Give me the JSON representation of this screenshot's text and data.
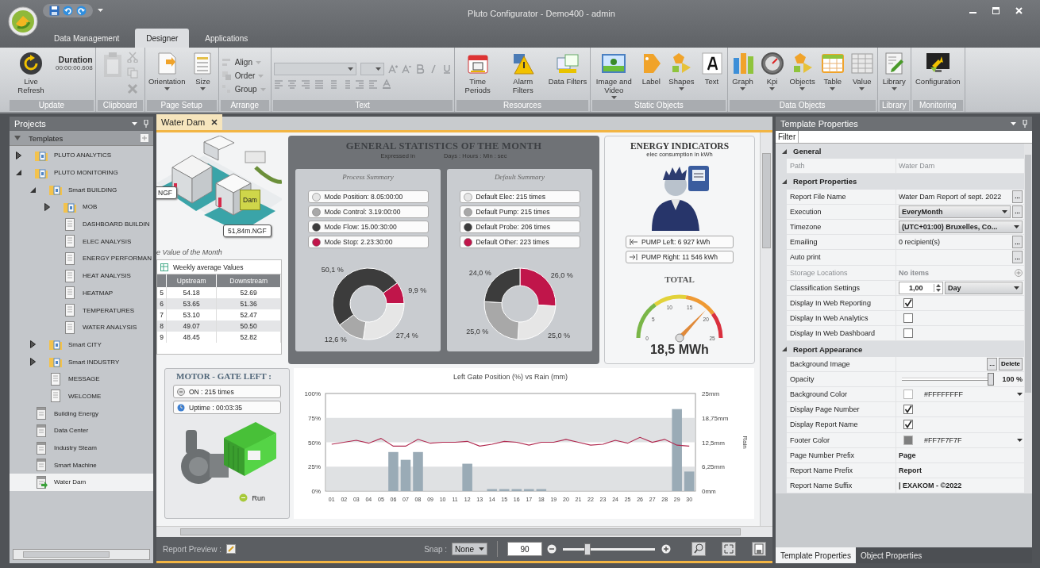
{
  "window": {
    "title": "Pluto Configurator - Demo400 - admin"
  },
  "ribbon_tabs": [
    {
      "label": "Data Management",
      "selected": false
    },
    {
      "label": "Designer",
      "selected": true
    },
    {
      "label": "Applications",
      "selected": false
    }
  ],
  "ribbon_groups": [
    {
      "label": "Update",
      "kind": "buttons",
      "items": [
        {
          "kind": "large",
          "label": "Live Refresh",
          "dropdown": false,
          "disabled": false
        },
        {
          "kind": "info",
          "title": "Duration",
          "value": "00:00:00.608"
        }
      ]
    },
    {
      "label": "Clipboard",
      "kind": "clipboard",
      "disabled": true
    },
    {
      "label": "Page Setup",
      "kind": "buttons",
      "items": [
        {
          "kind": "large",
          "label": "Orientation",
          "dropdown": true,
          "disabled": false
        },
        {
          "kind": "large",
          "label": "Size",
          "dropdown": true,
          "disabled": false
        }
      ]
    },
    {
      "label": "Arrange",
      "kind": "buttons",
      "items": [
        {
          "kind": "small",
          "label": "Align",
          "dropdown": true,
          "disabled": true
        },
        {
          "kind": "small",
          "label": "Order",
          "dropdown": true,
          "disabled": true
        },
        {
          "kind": "small",
          "label": "Group",
          "dropdown": true,
          "disabled": true
        }
      ]
    },
    {
      "label": "Text",
      "kind": "text-format",
      "disabled": true
    },
    {
      "label": "Resources",
      "kind": "buttons",
      "items": [
        {
          "kind": "large",
          "label": "Time Periods",
          "dropdown": false,
          "disabled": false
        },
        {
          "kind": "large",
          "label": "Alarm Filters",
          "dropdown": false,
          "disabled": false
        },
        {
          "kind": "large",
          "label": "Data Filters",
          "dropdown": false,
          "disabled": false
        }
      ]
    },
    {
      "label": "Static Objects",
      "kind": "buttons",
      "items": [
        {
          "kind": "large",
          "label": "Image and Video",
          "dropdown": true,
          "disabled": false
        },
        {
          "kind": "large",
          "label": "Label",
          "dropdown": false,
          "disabled": false
        },
        {
          "kind": "large",
          "label": "Shapes",
          "dropdown": true,
          "disabled": false
        },
        {
          "kind": "large",
          "label": "Text",
          "dropdown": false,
          "disabled": false
        }
      ]
    },
    {
      "label": "Data Objects",
      "kind": "buttons",
      "items": [
        {
          "kind": "large",
          "label": "Graph",
          "dropdown": true,
          "disabled": false
        },
        {
          "kind": "large",
          "label": "Kpi",
          "dropdown": true,
          "disabled": false
        },
        {
          "kind": "large",
          "label": "Objects",
          "dropdown": true,
          "disabled": false
        },
        {
          "kind": "large",
          "label": "Table",
          "dropdown": true,
          "disabled": false
        },
        {
          "kind": "large",
          "label": "Value",
          "dropdown": true,
          "disabled": false
        }
      ]
    },
    {
      "label": "Library",
      "kind": "buttons",
      "items": [
        {
          "kind": "large",
          "label": "Library",
          "dropdown": true,
          "disabled": false
        }
      ]
    },
    {
      "label": "Monitoring",
      "kind": "buttons",
      "items": [
        {
          "kind": "large",
          "label": "Configuration",
          "dropdown": false,
          "disabled": false
        }
      ]
    }
  ],
  "projects": {
    "title": "Projects",
    "root": {
      "label": "Templates",
      "expanded": true
    },
    "tree": [
      {
        "label": "PLUTO ANALYTICS",
        "kind": "folder",
        "expanded": false,
        "selected": false
      },
      {
        "label": "PLUTO MONITORING",
        "kind": "folder",
        "expanded": true,
        "selected": false,
        "children": [
          {
            "label": "Smart BUILDING",
            "kind": "folder",
            "expanded": true,
            "selected": false,
            "children": [
              {
                "label": "MOB",
                "kind": "folder",
                "expanded": false,
                "selected": false
              },
              {
                "label": "DASHBOARD BUILDIN",
                "kind": "page",
                "selected": false
              },
              {
                "label": "ELEC ANALYSIS",
                "kind": "page",
                "selected": false
              },
              {
                "label": "ENERGY PERFORMAN",
                "kind": "page",
                "selected": false
              },
              {
                "label": "HEAT ANALYSIS",
                "kind": "page",
                "selected": false
              },
              {
                "label": "HEATMAP",
                "kind": "page",
                "selected": false
              },
              {
                "label": "TEMPERATURES",
                "kind": "page",
                "selected": false
              },
              {
                "label": "WATER ANALYSIS",
                "kind": "page",
                "selected": false
              }
            ]
          },
          {
            "label": "Smart CITY",
            "kind": "folder",
            "expanded": false,
            "selected": false
          },
          {
            "label": "Smart INDUSTRY",
            "kind": "folder",
            "expanded": false,
            "selected": false
          },
          {
            "label": "MESSAGE",
            "kind": "page",
            "selected": false
          },
          {
            "label": "WELCOME",
            "kind": "page",
            "selected": false
          }
        ]
      },
      {
        "label": "Building Energy",
        "kind": "template",
        "selected": false
      },
      {
        "label": "Data Center",
        "kind": "template",
        "selected": false
      },
      {
        "label": "Industry Steam",
        "kind": "template",
        "selected": false
      },
      {
        "label": "Smart Machine",
        "kind": "template",
        "selected": false
      },
      {
        "label": "Water Dam",
        "kind": "template",
        "selected": true
      }
    ]
  },
  "document_tab": {
    "label": "Water Dam"
  },
  "dam": {
    "level_label": "NGF",
    "callout": "Dam",
    "elevation": "51,84m.NGF",
    "caption": "e Value of the Month",
    "table": {
      "title": "Weekly average Values",
      "columns": [
        "",
        "Upstream",
        "Downstream"
      ],
      "rows": [
        [
          "5",
          "54.18",
          "52.69"
        ],
        [
          "6",
          "53.65",
          "51.36"
        ],
        [
          "7",
          "53.10",
          "52.47"
        ],
        [
          "8",
          "49.07",
          "50.50"
        ],
        [
          "9",
          "48.45",
          "52.82"
        ]
      ]
    }
  },
  "statistics": {
    "title": "GENERAL STATISTICS OF THE MONTH",
    "subtitle_left": "Expressed in",
    "subtitle_right": "Days : Hours : Min : sec",
    "summaries": [
      {
        "title": "Process Summary",
        "items": [
          {
            "label": "Mode Position: 8.05:00:00",
            "color": "#e6e6e6"
          },
          {
            "label": "Mode Control: 3.19:00:00",
            "color": "#a8a8a8"
          },
          {
            "label": "Mode Flow: 15.00:30:00",
            "color": "#3c3c3c"
          },
          {
            "label": "Mode Stop: 2.23:30:00",
            "color": "#c0154a"
          }
        ],
        "chart_data": {
          "type": "donut",
          "values": [
            27.4,
            12.6,
            50.1,
            9.9
          ],
          "value_labels": [
            "27,4 %",
            "12,6 %",
            "50,1 %",
            "9,9 %"
          ]
        }
      },
      {
        "title": "Default Summary",
        "items": [
          {
            "label": "Default Elec: 215 times",
            "color": "#e6e6e6"
          },
          {
            "label": "Default Pump: 215 times",
            "color": "#a8a8a8"
          },
          {
            "label": "Default Probe: 206 times",
            "color": "#3c3c3c"
          },
          {
            "label": "Default Other: 223 times",
            "color": "#c0154a"
          }
        ],
        "chart_data": {
          "type": "donut",
          "values": [
            25.0,
            25.0,
            24.0,
            26.0
          ],
          "value_labels": [
            "25,0 %",
            "25,0 %",
            "24,0 %",
            "26,0 %"
          ]
        }
      }
    ]
  },
  "energy": {
    "title": "ENERGY INDICATORS",
    "subtitle": "elec consumption in kWh",
    "pumps": [
      "PUMP Left: 6 927 kWh",
      "PUMP Right: 11 546 kWh"
    ],
    "total_label": "TOTAL",
    "gauge": {
      "ticks": [
        "0",
        "5",
        "10",
        "15",
        "20",
        "25"
      ],
      "level": 0.74,
      "reading": "18,5 MWh"
    }
  },
  "motor": {
    "title": "MOTOR - GATE LEFT :",
    "stats": [
      "ON : 215 times",
      "Uptime : 00:03:35"
    ],
    "status": {
      "label": "Run",
      "on": true
    }
  },
  "chart": {
    "chart_data": {
      "type": "bar",
      "title": "Left Gate Position (%) vs Rain (mm)",
      "categories": [
        "01",
        "02",
        "03",
        "04",
        "05",
        "06",
        "07",
        "08",
        "09",
        "10",
        "11",
        "12",
        "13",
        "14",
        "15",
        "16",
        "17",
        "18",
        "19",
        "20",
        "21",
        "22",
        "23",
        "24",
        "25",
        "26",
        "27",
        "28",
        "29",
        "30"
      ],
      "ylim": [
        0,
        100
      ],
      "yticks": [
        {
          "value": 0,
          "label": "0%"
        },
        {
          "value": 25,
          "label": "25%"
        },
        {
          "value": 50,
          "label": "50%"
        },
        {
          "value": 75,
          "label": "75%"
        },
        {
          "value": 100,
          "label": "100%"
        }
      ],
      "y2label": "Rain",
      "y2lim": [
        0,
        25
      ],
      "y2ticks": [
        {
          "value": 0,
          "label": "0mm"
        },
        {
          "value": 6.25,
          "label": "6,25mm"
        },
        {
          "value": 12.5,
          "label": "12,5mm"
        },
        {
          "value": 18.75,
          "label": "18,75mm"
        },
        {
          "value": 25,
          "label": "25mm"
        }
      ],
      "series": [
        {
          "type": "bar",
          "color": "#9aabb6",
          "values": [
            0,
            0,
            0,
            0,
            0,
            40,
            32,
            40,
            0,
            0,
            0,
            28,
            0,
            2,
            2,
            2,
            2,
            2,
            0,
            0,
            0,
            0,
            0,
            0,
            0,
            0,
            0,
            0,
            84,
            20
          ]
        },
        {
          "type": "line",
          "color": "#b0294f",
          "values": [
            48,
            50,
            52,
            49,
            54,
            46,
            46,
            53,
            49,
            50,
            50,
            51,
            46,
            48,
            51,
            50,
            47,
            50,
            50,
            53,
            50,
            47,
            48,
            52,
            49,
            55,
            50,
            53,
            47,
            46
          ]
        }
      ]
    }
  },
  "bottom_bar": {
    "preview_label": "Report Preview :",
    "snap_label": "Snap :",
    "snap_value": "None",
    "zoom": {
      "value": "90",
      "level": 0.25
    }
  },
  "properties": {
    "title": "Template Properties",
    "filter_label": "Filter",
    "sections": [
      {
        "label": "General",
        "expanded": true,
        "rows": [
          {
            "label": "Path",
            "kind": "text",
            "value": "Water Dam",
            "disabled": true
          }
        ]
      },
      {
        "label": "Report Properties",
        "expanded": true,
        "rows": [
          {
            "label": "Report File Name",
            "kind": "text-button",
            "value": "Water Dam Report of sept. 2022",
            "button": "...",
            "disabled": false
          },
          {
            "label": "Execution",
            "kind": "dropdown-button",
            "value": "EveryMonth",
            "button": "...",
            "disabled": false
          },
          {
            "label": "Timezone",
            "kind": "dropdown",
            "value": "(UTC+01:00) Bruxelles, Co...",
            "disabled": false
          },
          {
            "label": "Emailing",
            "kind": "text-button",
            "value": "0 recipient(s)",
            "button": "...",
            "disabled": false
          },
          {
            "label": "Auto print",
            "kind": "text-button",
            "button": "...",
            "disabled": false
          },
          {
            "label": "Storage Locations",
            "kind": "collection",
            "value": "No items",
            "disabled": true
          },
          {
            "label": "Classification Settings",
            "kind": "spinner-dropdown",
            "value": "1,00",
            "option": "Day",
            "disabled": false
          },
          {
            "label": "Display In Web Reporting",
            "kind": "checkbox",
            "checked": true,
            "disabled": false
          },
          {
            "label": "Display In Web Analytics",
            "kind": "checkbox",
            "checked": false,
            "disabled": false
          },
          {
            "label": "Display In Web Dashboard",
            "kind": "checkbox",
            "checked": false,
            "disabled": false
          }
        ]
      },
      {
        "label": "Report Appearance",
        "expanded": true,
        "rows": [
          {
            "label": "Background Image",
            "kind": "image",
            "button": "...",
            "action": "Delete",
            "disabled": false
          },
          {
            "label": "Opacity",
            "kind": "slider",
            "level": 1,
            "reading": "100 %",
            "disabled": false
          },
          {
            "label": "Background Color",
            "kind": "color",
            "color": "#ffffff",
            "value": "#FFFFFFFF",
            "disabled": false
          },
          {
            "label": "Display Page Number",
            "kind": "checkbox",
            "checked": true,
            "disabled": false
          },
          {
            "label": "Display Report Name",
            "kind": "checkbox",
            "checked": true,
            "disabled": false
          },
          {
            "label": "Footer Color",
            "kind": "color",
            "color": "#7f7f7f",
            "value": "#FF7F7F7F",
            "disabled": false
          },
          {
            "label": "Page Number Prefix",
            "kind": "strong",
            "value": "Page",
            "disabled": false
          },
          {
            "label": "Report Name Prefix",
            "kind": "strong",
            "value": "Report",
            "disabled": false
          },
          {
            "label": "Report Name Suffix",
            "kind": "strong",
            "value": "| EXAKOM - ©2022",
            "disabled": false
          }
        ]
      }
    ],
    "tabs": [
      {
        "label": "Template Properties",
        "selected": true
      },
      {
        "label": "Object Properties",
        "selected": false
      }
    ]
  }
}
